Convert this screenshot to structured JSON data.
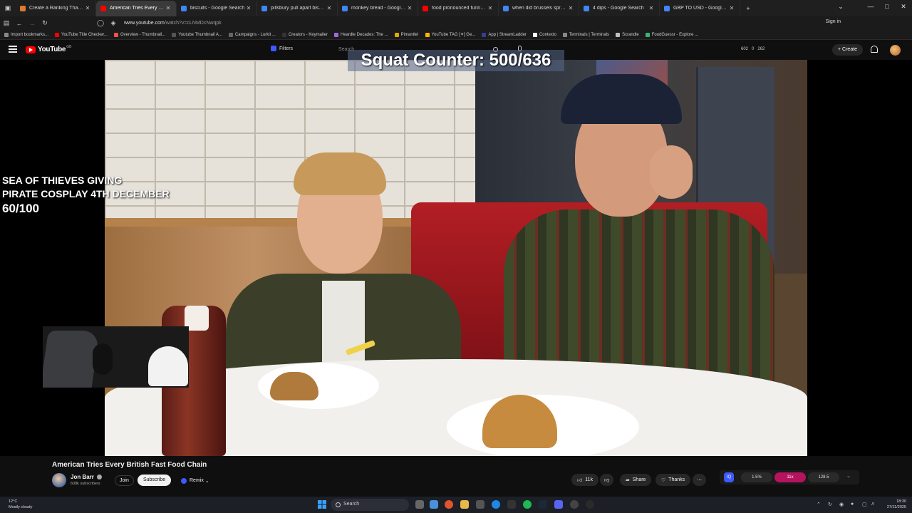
{
  "browser": {
    "tabs": [
      {
        "title": "Create a Ranking Thanksgiving",
        "active": false,
        "color": "#e07a2e"
      },
      {
        "title": "American Tries Every British",
        "active": true,
        "color": "#ff0000"
      },
      {
        "title": "biscuits - Google Search",
        "active": false,
        "color": "#4285f4"
      },
      {
        "title": "pillsbury pull apart biscuit - Go",
        "active": false,
        "color": "#4285f4"
      },
      {
        "title": "monkey bread - Google Search",
        "active": false,
        "color": "#4285f4"
      },
      {
        "title": "food pronounced funny - YouTu",
        "active": false,
        "color": "#ff0000"
      },
      {
        "title": "when did brussels sprouts beco",
        "active": false,
        "color": "#4285f4"
      },
      {
        "title": "4 dips - Google Search",
        "active": false,
        "color": "#4285f4"
      },
      {
        "title": "GBP TO USD - Google Search",
        "active": false,
        "color": "#4285f4"
      }
    ],
    "url_host": "www.youtube.com",
    "url_path": "/watch?v=cLNMDcNwqpk",
    "sign_in": "Sign in",
    "bookmarks": [
      {
        "label": "Import bookmarks...",
        "color": "#888888"
      },
      {
        "label": "YouTube Title Checker...",
        "color": "#ff0000"
      },
      {
        "label": "Overview - Thumbnail...",
        "color": "#ff4d4d"
      },
      {
        "label": "Youtube Thumbnail A...",
        "color": "#555555"
      },
      {
        "label": "Campaigns - Lurkit ...",
        "color": "#666666"
      },
      {
        "label": "Creators - Keymailer",
        "color": "#333333"
      },
      {
        "label": "Heardle Decades: The ...",
        "color": "#9c6ade"
      },
      {
        "label": "Pimantle!",
        "color": "#e0a800"
      },
      {
        "label": "YouTube TAG [✦] Ge...",
        "color": "#ffb300"
      },
      {
        "label": "App | StreamLadder",
        "color": "#3a3a9a"
      },
      {
        "label": "Contexto",
        "color": "#ffffff"
      },
      {
        "label": "Terminals | Terminals",
        "color": "#888888"
      },
      {
        "label": "Scrandle",
        "color": "#c0c0c0"
      },
      {
        "label": "FoodGuessr - Explore ...",
        "color": "#3cb371"
      }
    ]
  },
  "youtube": {
    "logo_text": "YouTube",
    "region": "GB",
    "filters_label": "Filters",
    "search_placeholder": "Search",
    "stats": [
      "602",
      "0",
      "262"
    ],
    "create_label": "Create"
  },
  "overlay": {
    "squat_counter": "Squat Counter: 500/636",
    "goal_line1": "SEA OF THIEVES GIVING",
    "goal_line2": "PIRATE COSPLAY 4TH DECEMBER",
    "goal_progress": "60/100"
  },
  "video_info": {
    "title": "American Tries Every British Fast Food Chain",
    "channel": "Jon Barr",
    "subscribers": "608k subscribers",
    "join_label": "Join",
    "subscribe_label": "Subscribe",
    "remix_label": "Remix",
    "likes": "11k",
    "share_label": "Share",
    "thanks_label": "Thanks"
  },
  "rating_bar": {
    "badge": "IQ",
    "values": [
      "1.5%",
      "11x",
      "128.5"
    ]
  },
  "taskbar": {
    "temperature": "12°C",
    "weather": "Mostly cloudy",
    "search_label": "Search",
    "time": "18:30",
    "date": "27/11/2025"
  }
}
